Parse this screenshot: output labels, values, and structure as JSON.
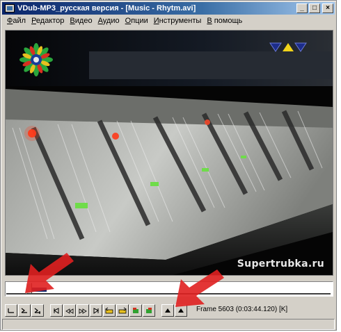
{
  "window": {
    "title": "VDub-MP3_русская версия - [Music - Rhytm.avi]",
    "minimize": "_",
    "maximize": "□",
    "close": "×"
  },
  "menu": [
    {
      "label": "Файл",
      "underline": "Ф",
      "rest": "айл"
    },
    {
      "label": "Редактор",
      "underline": "Р",
      "rest": "едактор"
    },
    {
      "label": "Видео",
      "underline": "В",
      "rest": "идео"
    },
    {
      "label": "Аудио",
      "underline": "А",
      "rest": "удио"
    },
    {
      "label": "Опции",
      "underline": "О",
      "rest": "пции"
    },
    {
      "label": "Инструменты",
      "underline": "И",
      "rest": "нструменты"
    },
    {
      "label": "В помощь",
      "underline": "В",
      "rest": " помощь"
    }
  ],
  "video": {
    "watermark": "Supertrubka.ru"
  },
  "seek": {
    "position_fraction": 0.068
  },
  "toolbar": {
    "buttons": [
      "stop-icon",
      "play-input-icon",
      "play-output-icon",
      "go-start-icon",
      "prev-frame-icon",
      "next-frame-icon",
      "go-end-icon",
      "prev-key-icon",
      "next-key-icon",
      "prev-scene-icon",
      "next-scene-icon",
      "mark-in-icon",
      "mark-out-icon"
    ]
  },
  "status": {
    "frame_info": "Frame 5603 (0:03:44.120) [K]"
  },
  "colors": {
    "title_start": "#0a246a",
    "title_end": "#a6caf0",
    "annotation_arrow": "#e02020"
  }
}
